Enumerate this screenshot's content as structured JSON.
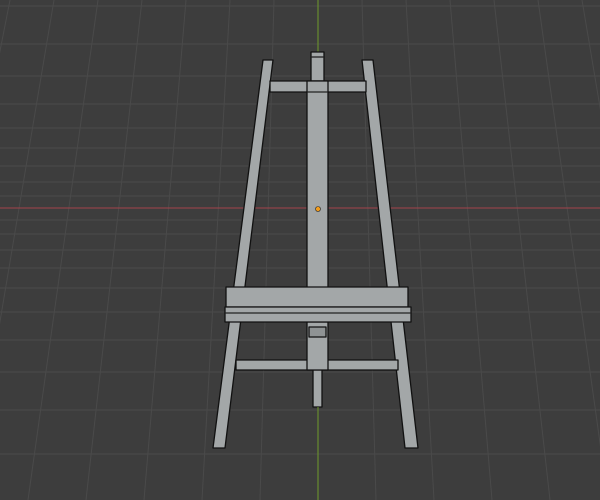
{
  "viewport": {
    "background_color": "#3d3d3d",
    "grid_color": "#4a4a4a",
    "x_axis_color": "#a2444c",
    "y_axis_color": "#6f9a2a",
    "origin_color": "#f39c1b"
  },
  "model": {
    "name_icon": "easel-mesh",
    "fill_color": "#a3a7a8",
    "edge_color": "#111111"
  }
}
